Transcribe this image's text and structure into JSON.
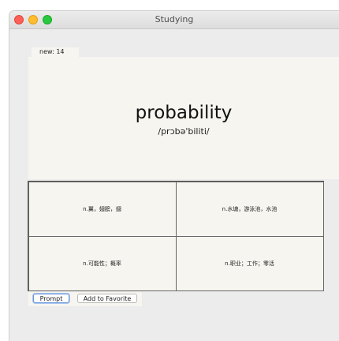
{
  "window": {
    "title": "Studying"
  },
  "stats": {
    "new_label": "new:",
    "new_count": "14"
  },
  "card": {
    "word": "probability",
    "phonetic": "/prɔbə'biliti/"
  },
  "options": [
    {
      "text": "n.翼，翅膀，翅"
    },
    {
      "text": "n.水塘，游泳池，水池"
    },
    {
      "text": "n.可能性；概率"
    },
    {
      "text": "n.职业；工作；零活"
    }
  ],
  "buttons": {
    "prompt": "Prompt",
    "favorite": "Add to Favorite"
  }
}
